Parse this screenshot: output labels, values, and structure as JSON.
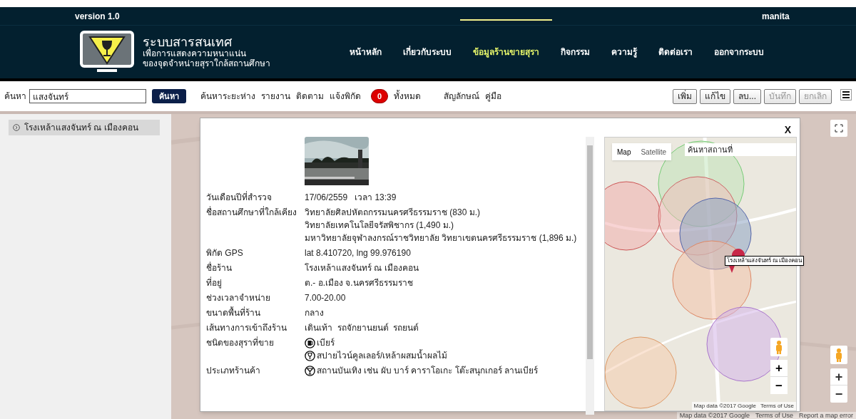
{
  "header": {
    "version": "version 1.0",
    "user": "manita",
    "title": "ระบบสารสนเทศ",
    "subtitle_lines": [
      "เพื่อการแสดงความหนาแน่น",
      "ของจุดจำหน่ายสุราใกล้สถานศึกษา"
    ],
    "nav": [
      {
        "label": "หน้าหลัก",
        "selected": false
      },
      {
        "label": "เกี่ยวกับระบบ",
        "selected": false
      },
      {
        "label": "ข้อมูลร้านขายสุรา",
        "selected": true
      },
      {
        "label": "กิจกรรม",
        "selected": false
      },
      {
        "label": "ความรู้",
        "selected": false
      },
      {
        "label": "ติดต่อเรา",
        "selected": false
      },
      {
        "label": "ออกจากระบบ",
        "selected": false
      }
    ]
  },
  "toolbar": {
    "search_label": "ค้นหา",
    "search_value": "แสงจันทร์",
    "search_button": "ค้นหา",
    "links": [
      "ค้นหาระยะห่าง",
      "รายงาน",
      "ติดตาม",
      "แจ้งพิกัด"
    ],
    "badge": "0",
    "badge_label": "ทั้งหมด",
    "links2": [
      "สัญลักษณ์",
      "คู่มือ"
    ],
    "buttons": [
      {
        "label": "เพิ่ม",
        "disabled": false
      },
      {
        "label": "แก้ไข",
        "disabled": false
      },
      {
        "label": "ลบ...",
        "disabled": false
      },
      {
        "label": "บันทึก",
        "disabled": true
      },
      {
        "label": "ยกเลิก",
        "disabled": true
      }
    ]
  },
  "sidebar": {
    "items": [
      {
        "label": "โรงเหล้าแสงจันทร์ ณ เมืองคอน"
      }
    ]
  },
  "modal": {
    "close": "X",
    "details": [
      {
        "label": "วันเดือนปีที่สำรวจ",
        "values": [
          {
            "text": "17/06/2559   เวลา 13:39"
          }
        ]
      },
      {
        "label": "ชื่อสถานศึกษาที่ใกล้เคียง",
        "values": [
          {
            "text": "วิทยาลัยศิลปหัตถกรรมนครศรีธรรมราช (830 ม.)"
          },
          {
            "text": "วิทยาลัยเทคโนโลยีจรัสพิชากร (1,490 ม.)"
          },
          {
            "text": "มหาวิทยาลัยจุฬาลงกรณ์ราชวิทยาลัย วิทยาเขตนครศรีธรรมราช (1,896 ม.)"
          }
        ]
      },
      {
        "label": "พิกัด GPS",
        "values": [
          {
            "text": "lat 8.410720, lng 99.976190"
          }
        ]
      },
      {
        "label": "ชื่อร้าน",
        "values": [
          {
            "text": "โรงเหล้าแสงจันทร์ ณ เมืองคอน"
          }
        ]
      },
      {
        "label": "ที่อยู่",
        "values": [
          {
            "text": "ต.- อ.เมือง จ.นครศรีธรรมราช"
          }
        ]
      },
      {
        "label": "ช่วงเวลาจำหน่าย",
        "values": [
          {
            "text": "7.00-20.00"
          }
        ]
      },
      {
        "label": "ขนาดพื้นที่ร้าน",
        "values": [
          {
            "text": "กลาง"
          }
        ]
      },
      {
        "label": "เส้นทางการเข้าถึงร้าน",
        "values": [
          {
            "text": "เดินเท้า  รถจักยานยนต์  รถยนต์"
          }
        ]
      },
      {
        "label": "ชนิดของสุราที่ขาย",
        "values": [
          {
            "text": "เบียร์",
            "kind": "beer"
          },
          {
            "text": "สปายไวน์คูลเลอร์/เหล้าผสมน้ำผลไม้",
            "kind": "cocktail"
          }
        ]
      },
      {
        "label": "ประเภทร้านค้า",
        "values": [
          {
            "text": "สถานบันเทิง เช่น ผับ บาร์ คาราโอเกะ โต๊ะสนุกเกอร์ ลานเบียร์",
            "kind": "martini"
          }
        ]
      }
    ],
    "map": {
      "map_button": {
        "label": "Map",
        "selected": true
      },
      "satellite_button": {
        "label": "Satellite",
        "selected": false
      },
      "search_placeholder": "ค้นหาสถานที่",
      "tooltip": "โรงเหล้าแสงจันทร์ ณ เมืองคอน",
      "zoom_in": "+",
      "zoom_out": "−",
      "attribution": "Map data ©2017 Google",
      "terms": "Terms of Use"
    }
  },
  "background_map": {
    "zoom_in": "+",
    "zoom_out": "−",
    "attribution": "Map data ©2017 Google",
    "terms": "Terms of Use",
    "report": "Report a map error"
  }
}
